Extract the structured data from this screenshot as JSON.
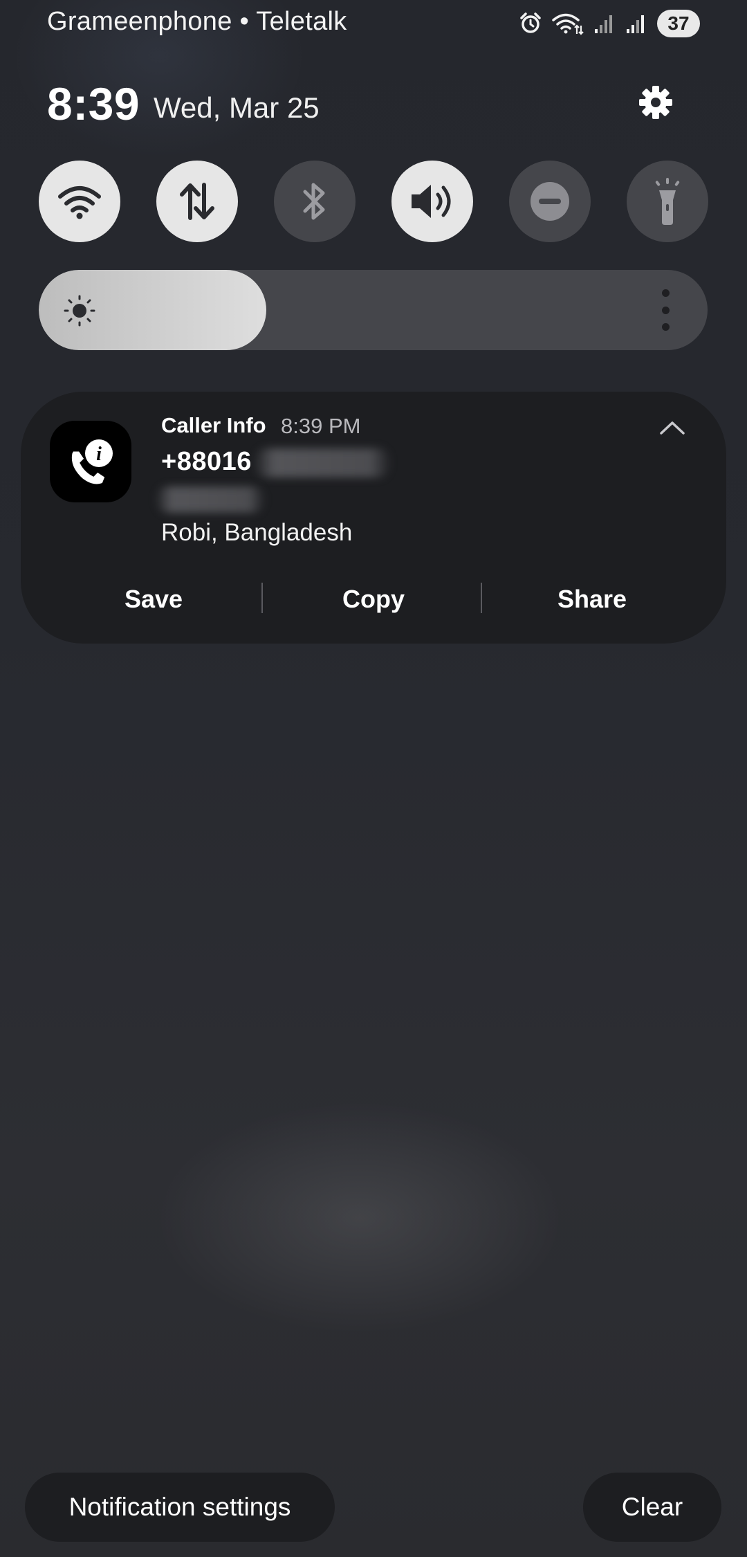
{
  "status_bar": {
    "carrier": "Grameenphone • Teletalk",
    "icons": [
      "alarm-icon",
      "wifi-data-icon",
      "signal-sim1-icon",
      "signal-sim2-icon"
    ],
    "battery": "37"
  },
  "header": {
    "time": "8:39",
    "date": "Wed, Mar 25",
    "settings_icon": "gear-icon"
  },
  "quick_toggles": [
    {
      "name": "wifi",
      "icon": "wifi-icon",
      "state": "on"
    },
    {
      "name": "mobile-data",
      "icon": "data-arrows-icon",
      "state": "on"
    },
    {
      "name": "bluetooth",
      "icon": "bluetooth-icon",
      "state": "off"
    },
    {
      "name": "sound",
      "icon": "speaker-icon",
      "state": "on"
    },
    {
      "name": "do-not-disturb",
      "icon": "minus-circle-icon",
      "state": "off"
    },
    {
      "name": "flashlight",
      "icon": "flashlight-icon",
      "state": "off"
    }
  ],
  "brightness": {
    "level": 0.34,
    "icon": "sun-icon",
    "menu_icon": "more-vertical-icon"
  },
  "notification": {
    "app_name": "Caller Info",
    "time": "8:39 PM",
    "number_visible": "+88016",
    "location": "Robi, Bangladesh",
    "actions": {
      "save": "Save",
      "copy": "Copy",
      "share": "Share"
    },
    "icon": "caller-info-icon",
    "collapse_icon": "chevron-up-icon"
  },
  "footer": {
    "notification_settings": "Notification settings",
    "clear": "Clear"
  },
  "colors": {
    "background": "#27292f",
    "card": "#1d1e21",
    "toggle_on": "#e6e6e6",
    "toggle_off": "#45464b"
  }
}
